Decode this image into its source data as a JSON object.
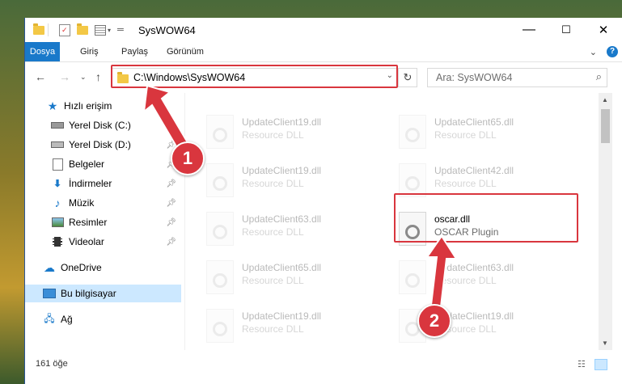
{
  "window": {
    "title": "SysWOW64",
    "minimize": "—",
    "maximize": "☐",
    "close": "✕"
  },
  "ribbon": {
    "tabs": [
      "Dosya",
      "Giriş",
      "Paylaş",
      "Görünüm"
    ],
    "help": "?"
  },
  "address": {
    "path": "C:\\Windows\\SysWOW64",
    "search_placeholder": "Ara: SysWOW64"
  },
  "sidebar": {
    "items": [
      {
        "label": "Hızlı erişim",
        "icon": "star-icon",
        "pinned": false
      },
      {
        "label": "Yerel Disk (C:)",
        "icon": "drive-c-icon",
        "pinned": true
      },
      {
        "label": "Yerel Disk (D:)",
        "icon": "drive-d-icon",
        "pinned": true
      },
      {
        "label": "Belgeler",
        "icon": "documents-icon",
        "pinned": true
      },
      {
        "label": "İndirmeler",
        "icon": "downloads-icon",
        "pinned": true
      },
      {
        "label": "Müzik",
        "icon": "music-icon",
        "pinned": true
      },
      {
        "label": "Resimler",
        "icon": "pictures-icon",
        "pinned": true
      },
      {
        "label": "Videolar",
        "icon": "videos-icon",
        "pinned": true
      },
      {
        "label": "OneDrive",
        "icon": "onedrive-icon",
        "pinned": false
      },
      {
        "label": "Bu bilgisayar",
        "icon": "this-pc-icon",
        "pinned": false,
        "selected": true
      },
      {
        "label": "Ağ",
        "icon": "network-icon",
        "pinned": false
      }
    ]
  },
  "files": [
    {
      "name": "UpdateClient19.dll",
      "desc": "Resource DLL",
      "faded": true
    },
    {
      "name": "UpdateClient65.dll",
      "desc": "Resource DLL",
      "faded": true
    },
    {
      "name": "UpdateClient19.dll",
      "desc": "Resource DLL",
      "faded": true
    },
    {
      "name": "UpdateClient42.dll",
      "desc": "Resource DLL",
      "faded": true
    },
    {
      "name": "UpdateClient63.dll",
      "desc": "Resource DLL",
      "faded": true
    },
    {
      "name": "oscar.dll",
      "desc": "OSCAR Plugin",
      "faded": false
    },
    {
      "name": "UpdateClient65.dll",
      "desc": "Resource DLL",
      "faded": true
    },
    {
      "name": "UpdateClient63.dll",
      "desc": "Resource DLL",
      "faded": true
    },
    {
      "name": "UpdateClient19.dll",
      "desc": "Resource DLL",
      "faded": true
    },
    {
      "name": "UpdateClient19.dll",
      "desc": "Resource DLL",
      "faded": true
    }
  ],
  "status": {
    "count": "161 öğe"
  },
  "annotations": {
    "step1": "1",
    "step2": "2",
    "color": "#d9363e"
  }
}
